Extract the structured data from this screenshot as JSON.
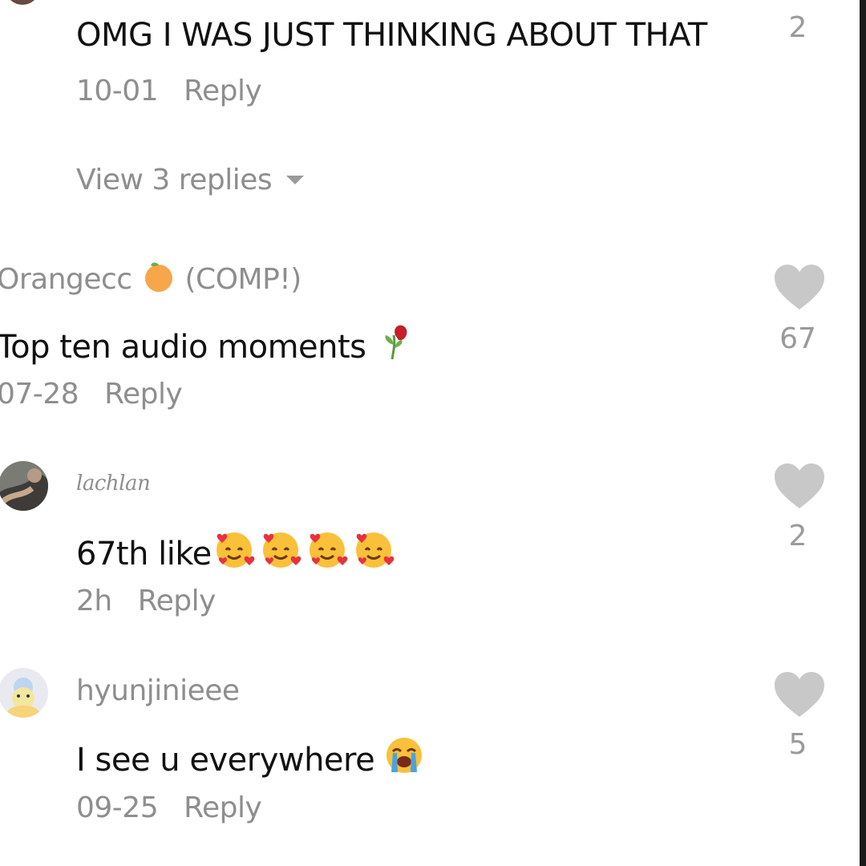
{
  "comments": [
    {
      "text": "OMG I WAS JUST THINKING ABOUT THAT",
      "date": "10-01",
      "reply_label": "Reply",
      "likes": "2",
      "view_replies": "View 3 replies"
    },
    {
      "username": "Orangecc",
      "username_suffix": "(COMP!)",
      "username_emoji": "tangerine-emoji",
      "text": "Top ten audio moments",
      "text_emoji": "wilted-flower-emoji",
      "date": "07-28",
      "reply_label": "Reply",
      "likes": "67"
    },
    {
      "username": "lachlan",
      "text": "67th like",
      "text_emoji": "smiling-face-with-hearts-emoji x4",
      "date": "2h",
      "reply_label": "Reply",
      "likes": "2"
    },
    {
      "username": "hyunjinieee",
      "text": "I see u everywhere",
      "text_emoji": "loudly-crying-face-emoji",
      "date": "09-25",
      "reply_label": "Reply",
      "likes": "5"
    }
  ],
  "colors": {
    "text": "#111111",
    "muted": "#8e8e8e",
    "heart": "#c8c8c8",
    "background": "#ffffff"
  }
}
